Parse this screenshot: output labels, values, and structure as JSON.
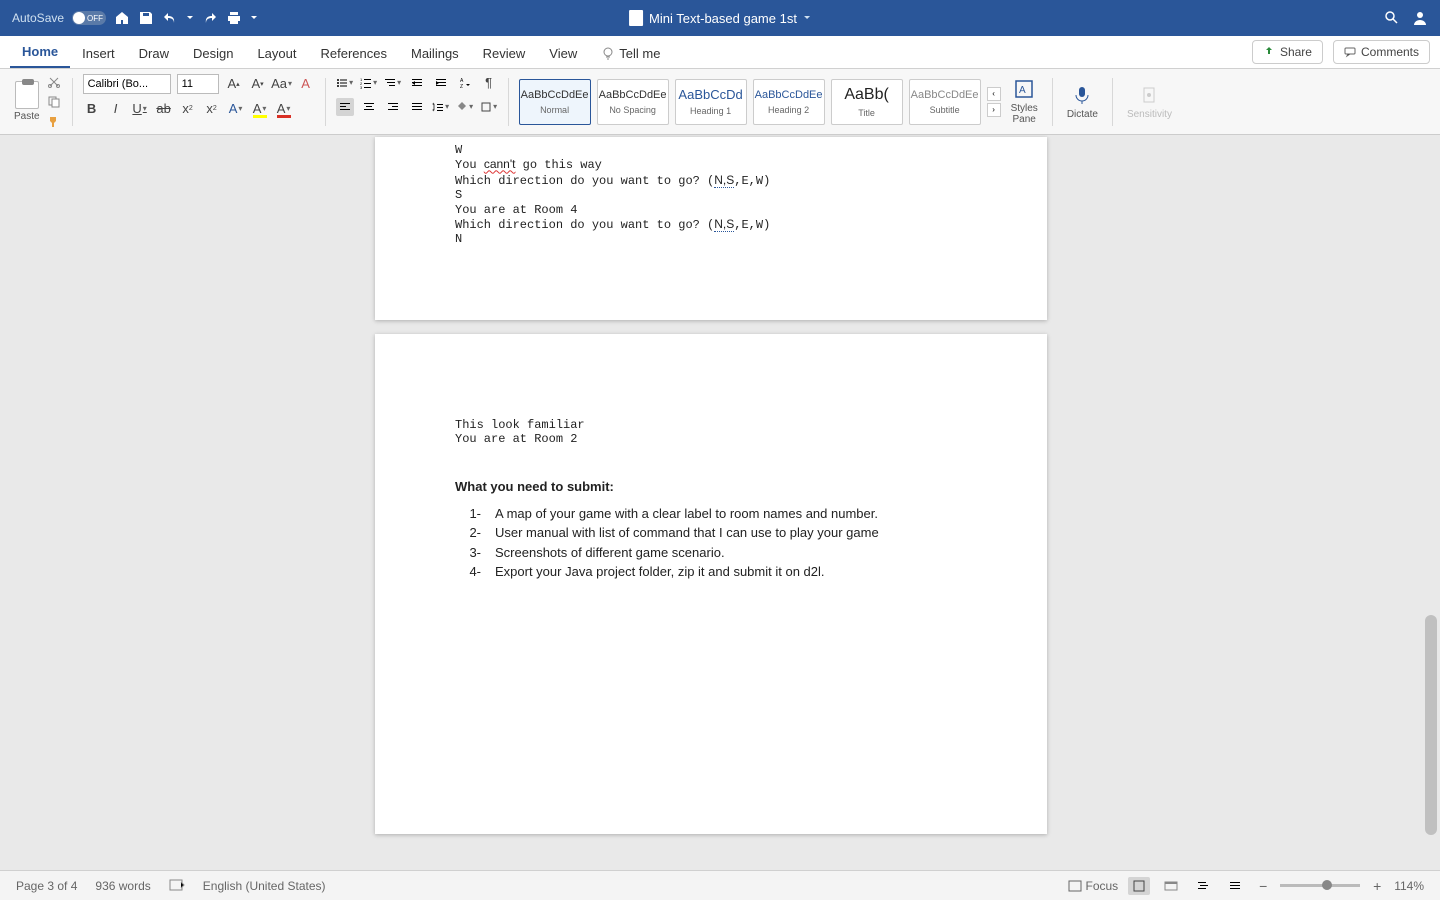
{
  "titlebar": {
    "autosave_label": "AutoSave",
    "autosave_off": "OFF",
    "document_title": "Mini Text-based game 1st"
  },
  "tabs": {
    "home": "Home",
    "insert": "Insert",
    "draw": "Draw",
    "design": "Design",
    "layout": "Layout",
    "references": "References",
    "mailings": "Mailings",
    "review": "Review",
    "view": "View",
    "tellme": "Tell me",
    "share": "Share",
    "comments": "Comments"
  },
  "ribbon": {
    "paste": "Paste",
    "font_name": "Calibri (Bo...",
    "font_size": "11",
    "styles": {
      "normal_preview": "AaBbCcDdEe",
      "normal": "Normal",
      "nospacing_preview": "AaBbCcDdEe",
      "nospacing": "No Spacing",
      "heading1_preview": "AaBbCcDd",
      "heading1": "Heading 1",
      "heading2_preview": "AaBbCcDdEe",
      "heading2": "Heading 2",
      "title_preview": "AaBb(",
      "title": "Title",
      "subtitle_preview": "AaBbCcDdEe",
      "subtitle": "Subtitle"
    },
    "styles_pane": "Styles\nPane",
    "dictate": "Dictate",
    "sensitivity": "Sensitivity"
  },
  "document": {
    "page1_lines": [
      "W",
      "You cann't go this way",
      "Which direction do you want to go? (N,S,E,W)",
      "S",
      "You are at Room 4",
      "Which direction do you want to go? (N,S,E,W)",
      "N"
    ],
    "page2_mono": [
      "This look familiar",
      "You are at Room 2"
    ],
    "submit_heading": "What you need to submit:",
    "submit_items": [
      "A map of your game with a clear label to room names and number.",
      "User manual with list of command that I can use to play your game",
      "Screenshots of different game scenario.",
      "Export your Java project folder, zip it and submit it on d2l."
    ]
  },
  "statusbar": {
    "page": "Page 3 of 4",
    "words": "936 words",
    "language": "English (United States)",
    "focus": "Focus",
    "zoom": "114%"
  },
  "colors": {
    "brand": "#2a5699",
    "highlight": "#ffff00",
    "font_color": "#d93025"
  }
}
